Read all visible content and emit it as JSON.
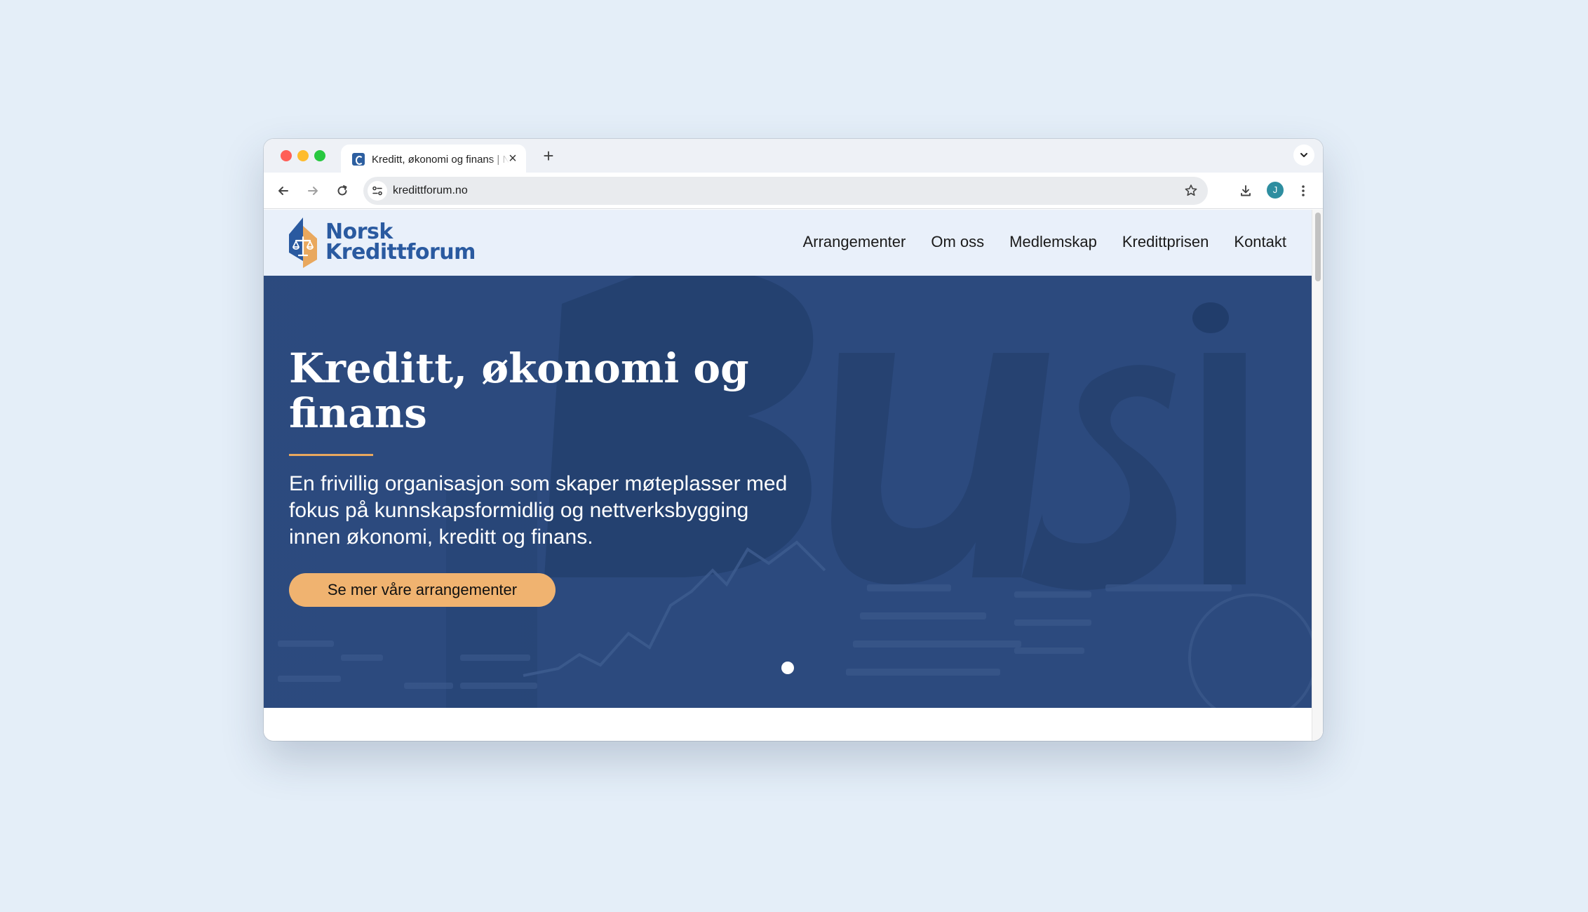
{
  "browser": {
    "tab_title": "Kreditt, økonomi og finans | Norsk Kredittforum",
    "tab_close": "×",
    "new_tab": "+",
    "url": "kredittforum.no",
    "avatar_initial": "J"
  },
  "site": {
    "logo_line1": "Norsk",
    "logo_line2": "Kredittforum",
    "nav": [
      "Arrangementer",
      "Om oss",
      "Medlemskap",
      "Kredittprisen",
      "Kontakt"
    ]
  },
  "hero": {
    "title": "Kreditt, økonomi og finans",
    "lead": "En frivillig organisasjon som skaper møteplasser med fokus på kunnskapsformidlig og nettverksbygging innen økonomi, kreditt og finans.",
    "cta_label": "Se mer våre arrangementer",
    "slide_count": 1,
    "active_slide": 1
  },
  "colors": {
    "brand_blue": "#2a5aa0",
    "brand_orange": "#e9a85e",
    "hero_background": "#2c4a7e",
    "cta_background": "#f0b370",
    "header_background": "#e9f0fa"
  },
  "icons": [
    "back-arrow-icon",
    "forward-arrow-icon",
    "reload-icon",
    "site-info-icon",
    "bookmark-star-icon",
    "download-icon",
    "more-vert-icon",
    "chevron-down-icon",
    "logo-scales-icon"
  ]
}
